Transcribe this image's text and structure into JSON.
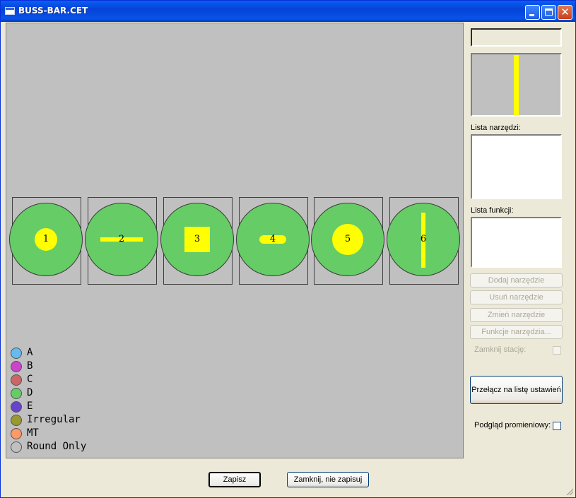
{
  "window": {
    "title": "BUSS-BAR.CET"
  },
  "colors": {
    "station": "#66cc66",
    "tool": "#ffff00",
    "canvas": "#c0c0c0"
  },
  "stations": [
    {
      "number": "1",
      "tool_shape": "round"
    },
    {
      "number": "2",
      "tool_shape": "horizontal-bar"
    },
    {
      "number": "3",
      "tool_shape": "square"
    },
    {
      "number": "4",
      "tool_shape": "obround"
    },
    {
      "number": "5",
      "tool_shape": "large-round"
    },
    {
      "number": "6",
      "tool_shape": "vertical-bar"
    }
  ],
  "legend": [
    {
      "label": "A",
      "color": "#66bbee"
    },
    {
      "label": "B",
      "color": "#cc44cc"
    },
    {
      "label": "C",
      "color": "#cc6666"
    },
    {
      "label": "D",
      "color": "#66cc66"
    },
    {
      "label": "E",
      "color": "#6644cc"
    },
    {
      "label": "Irregular",
      "color": "#999933"
    },
    {
      "label": "MT",
      "color": "#ff9966"
    },
    {
      "label": "Round Only",
      "color": "#c0c0c0"
    }
  ],
  "sidebar": {
    "preview_value": "",
    "tools_list_label": "Lista narzędzi:",
    "functions_list_label": "Lista funkcji:",
    "add_tool": "Dodaj narzędzie",
    "remove_tool": "Usuń narzędzie",
    "change_tool": "Zmień narzędzie",
    "tool_functions": "Funkcje narzędzia...",
    "close_station": "Zamknij stację:",
    "switch_list": "Przełącz na listę ustawień",
    "radial_preview": "Podgląd promieniowy:"
  },
  "footer": {
    "save": "Zapisz",
    "close_no_save": "Zamknij, nie zapisuj"
  }
}
